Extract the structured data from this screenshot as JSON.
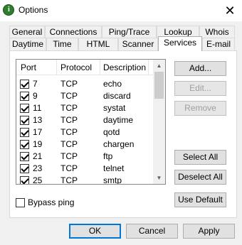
{
  "window": {
    "title": "Options",
    "icon": "info-icon"
  },
  "tabs_row1": [
    "General",
    "Connections",
    "Ping/Trace",
    "Lookup",
    "Whois"
  ],
  "tabs_row2": [
    "Daytime",
    "Time",
    "HTML",
    "Scanner",
    "Services",
    "E-mail"
  ],
  "active_tab": "Services",
  "list": {
    "headers": [
      "Port",
      "Protocol",
      "Description"
    ],
    "rows": [
      {
        "port": "7",
        "protocol": "TCP",
        "description": "echo",
        "checked": true
      },
      {
        "port": "9",
        "protocol": "TCP",
        "description": "discard",
        "checked": true
      },
      {
        "port": "11",
        "protocol": "TCP",
        "description": "systat",
        "checked": true
      },
      {
        "port": "13",
        "protocol": "TCP",
        "description": "daytime",
        "checked": true
      },
      {
        "port": "17",
        "protocol": "TCP",
        "description": "qotd",
        "checked": true
      },
      {
        "port": "19",
        "protocol": "TCP",
        "description": "chargen",
        "checked": true
      },
      {
        "port": "21",
        "protocol": "TCP",
        "description": "ftp",
        "checked": true
      },
      {
        "port": "23",
        "protocol": "TCP",
        "description": "telnet",
        "checked": true
      },
      {
        "port": "25",
        "protocol": "TCP",
        "description": "smtp",
        "checked": true
      }
    ]
  },
  "side_buttons": {
    "add": "Add...",
    "edit": "Edit...",
    "remove": "Remove",
    "select_all": "Select All",
    "deselect_all": "Deselect All",
    "use_default": "Use Default"
  },
  "bypass_ping": {
    "label": "Bypass ping",
    "checked": false
  },
  "footer": {
    "ok": "OK",
    "cancel": "Cancel",
    "apply": "Apply"
  }
}
